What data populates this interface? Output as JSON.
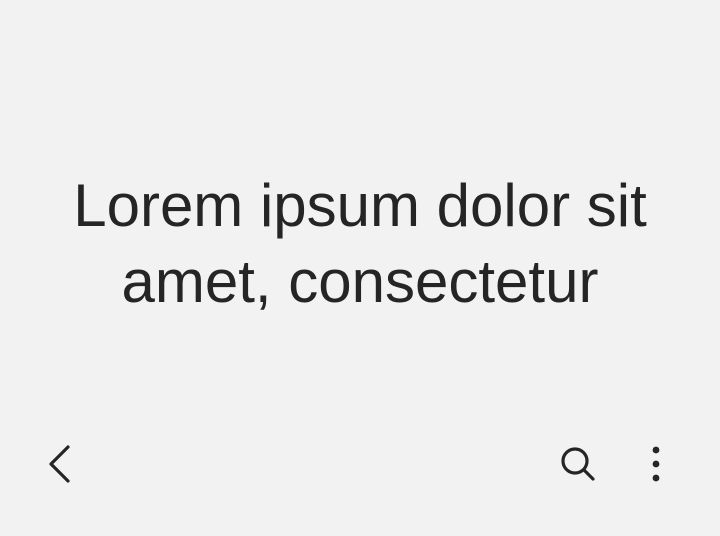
{
  "content": {
    "title_line_1": "Lorem ipsum dolor sit",
    "title_line_2": "amet, consectetur"
  },
  "toolbar": {
    "back_icon": "chevron-left-icon",
    "search_icon": "search-icon",
    "more_icon": "more-vertical-icon"
  },
  "colors": {
    "background": "#f2f2f2",
    "text": "#252525",
    "icon": "#252525"
  }
}
